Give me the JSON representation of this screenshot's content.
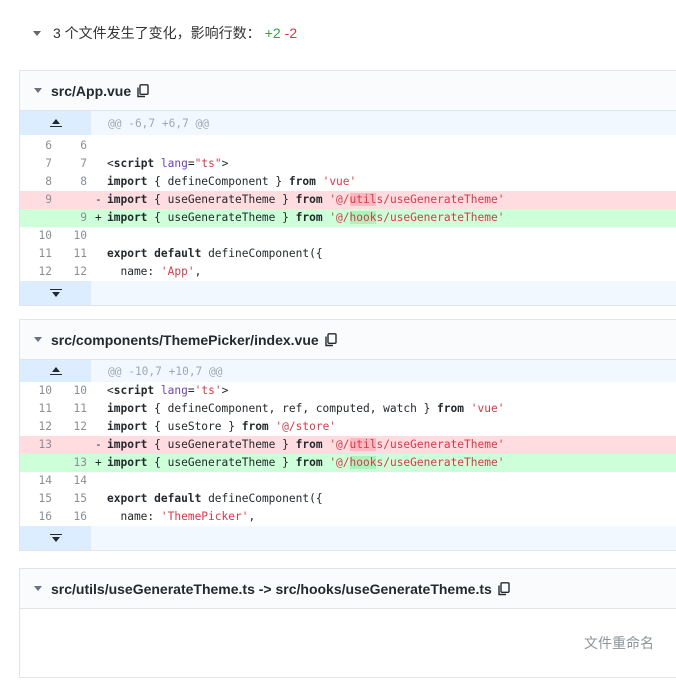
{
  "summary": {
    "text": "3 个文件发生了变化，影响行数：",
    "added": "+2",
    "deleted": "-2"
  },
  "files": [
    {
      "name": "src/App.vue",
      "hunk": "@@ -6,7 +6,7 @@"
    },
    {
      "name": "src/components/ThemePicker/index.vue",
      "hunk": "@@ -10,7 +10,7 @@"
    },
    {
      "name": "src/utils/useGenerateTheme.ts -> src/hooks/useGenerateTheme.ts",
      "note": "文件重命名"
    }
  ],
  "file1_lines": [
    {
      "type": "ctx",
      "old": "6",
      "new": "6",
      "code": ""
    },
    {
      "type": "ctx",
      "old": "7",
      "new": "7",
      "code": "<script lang=\"ts\">"
    },
    {
      "type": "ctx",
      "old": "8",
      "new": "8",
      "code": "import { defineComponent } from 'vue'"
    },
    {
      "type": "del",
      "old": "9",
      "new": "",
      "code": "import { useGenerateTheme } from '@/utils/useGenerateTheme'"
    },
    {
      "type": "add",
      "old": "",
      "new": "9",
      "code": "import { useGenerateTheme } from '@/hooks/useGenerateTheme'"
    },
    {
      "type": "ctx",
      "old": "10",
      "new": "10",
      "code": ""
    },
    {
      "type": "ctx",
      "old": "11",
      "new": "11",
      "code": "export default defineComponent({"
    },
    {
      "type": "ctx",
      "old": "12",
      "new": "12",
      "code": "  name: 'App',"
    }
  ],
  "file2_lines": [
    {
      "type": "ctx",
      "old": "10",
      "new": "10",
      "code": "<script lang='ts'>"
    },
    {
      "type": "ctx",
      "old": "11",
      "new": "11",
      "code": "import { defineComponent, ref, computed, watch } from 'vue'"
    },
    {
      "type": "ctx",
      "old": "12",
      "new": "12",
      "code": "import { useStore } from '@/store'"
    },
    {
      "type": "del",
      "old": "13",
      "new": "",
      "code": "import { useGenerateTheme } from '@/utils/useGenerateTheme'"
    },
    {
      "type": "add",
      "old": "",
      "new": "13",
      "code": "import { useGenerateTheme } from '@/hooks/useGenerateTheme'"
    },
    {
      "type": "ctx",
      "old": "14",
      "new": "14",
      "code": ""
    },
    {
      "type": "ctx",
      "old": "15",
      "new": "15",
      "code": "export default defineComponent({"
    },
    {
      "type": "ctx",
      "old": "16",
      "new": "16",
      "code": "  name: 'ThemePicker',"
    }
  ],
  "colors": {
    "added": "#28a745",
    "deleted": "#d73a49",
    "add_bg": "#cdffd8",
    "del_bg": "#ffdce0",
    "hunk_bg": "#f1f8ff"
  },
  "icons": [
    "caret-down-icon",
    "copy-icon",
    "expand-up-icon",
    "expand-down-icon"
  ]
}
